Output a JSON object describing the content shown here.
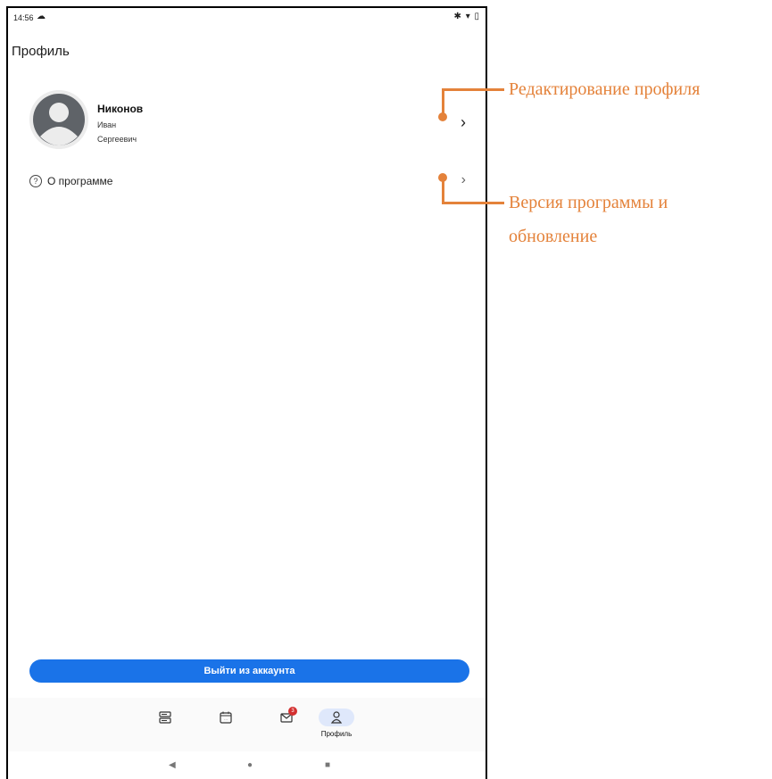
{
  "status_bar": {
    "time": "14:56",
    "cloud_icon": "cloud-icon",
    "right_icons": "✱ ▾ ▯"
  },
  "page": {
    "title": "Профиль"
  },
  "profile": {
    "surname": "Никонов",
    "given_name": "Иван",
    "patronymic": "Сергеевич",
    "avatar_icon": "person-icon",
    "chevron": "›"
  },
  "about": {
    "label": "О программе",
    "icon": "help-circle-icon",
    "chevron": "›"
  },
  "logout": {
    "label": "Выйти из аккаунта",
    "color": "#1a73e8"
  },
  "bottom_nav": {
    "items": [
      {
        "icon": "tasks-icon"
      },
      {
        "icon": "calendar-icon"
      },
      {
        "icon": "mail-icon",
        "badge": "3"
      },
      {
        "icon": "profile-icon",
        "label": "Профиль",
        "active": true
      }
    ]
  },
  "system_nav": {
    "back": "◀",
    "home": "●",
    "recents": "■"
  },
  "annotations": {
    "edit_profile": "Редактирование профиля",
    "version_line1": "Версия программы и",
    "version_line2": "обновление",
    "accent_color": "#e4823a"
  }
}
